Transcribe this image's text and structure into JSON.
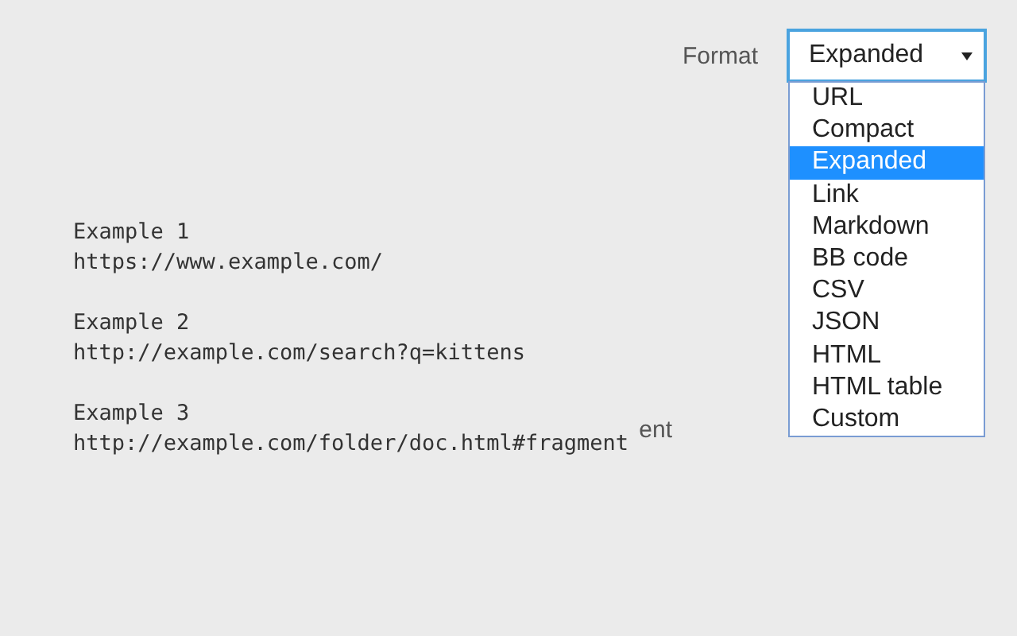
{
  "format": {
    "label": "Format",
    "value": "Expanded",
    "expanded": true,
    "options": [
      {
        "label": "URL",
        "selected": false
      },
      {
        "label": "Compact",
        "selected": false
      },
      {
        "label": "Expanded",
        "selected": true
      },
      {
        "label": "Link",
        "selected": false
      },
      {
        "label": "Markdown",
        "selected": false
      },
      {
        "label": "BB code",
        "selected": false
      },
      {
        "label": "CSV",
        "selected": false
      },
      {
        "label": "JSON",
        "selected": false
      },
      {
        "label": "HTML",
        "selected": false
      },
      {
        "label": "HTML table",
        "selected": false
      },
      {
        "label": "Custom",
        "selected": false
      }
    ]
  },
  "covered_label": "ent",
  "examples": [
    {
      "title": "Example 1",
      "url": "https://www.example.com/"
    },
    {
      "title": "Example 2",
      "url": "http://example.com/search?q=kittens"
    },
    {
      "title": "Example 3",
      "url": "http://example.com/folder/doc.html#fragment"
    }
  ]
}
